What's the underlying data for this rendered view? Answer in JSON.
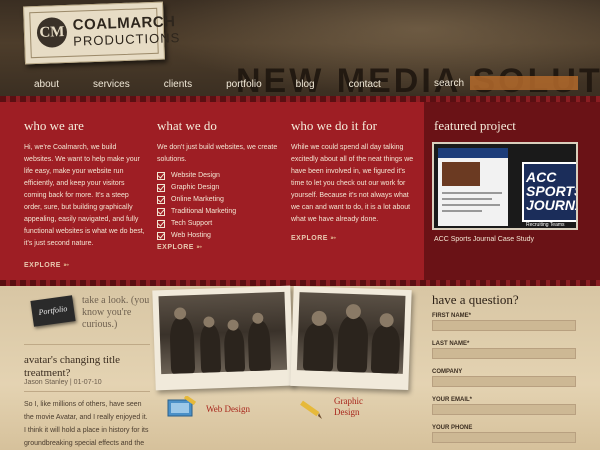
{
  "brand": {
    "logo_mark": "CM",
    "name": "COALMARCH",
    "sub": "PRODUCTIONS"
  },
  "hero": {
    "headline": "NEW MEDIA SOLUTIONS"
  },
  "nav": [
    "about",
    "services",
    "clients",
    "portfolio",
    "blog",
    "contact"
  ],
  "search": {
    "label": "search",
    "value": ""
  },
  "who_we_are": {
    "title": "who we are",
    "body": "Hi, we're Coalmarch, we build websites. We want to help make your life easy, make your website run efficiently, and keep your visitors coming back for more. It's a steep order, sure, but building graphically appealing, easily navigated, and fully functional websites is what we do best, it's just second nature.",
    "explore": "EXPLORE"
  },
  "what_we_do": {
    "title": "what we do",
    "intro": "We don't just build websites, we create solutions.",
    "services": [
      "Website Design",
      "Graphic Design",
      "Online Marketing",
      "Traditional Marketing",
      "Tech Support",
      "Web Hosting"
    ],
    "explore": "EXPLORE"
  },
  "why": {
    "title": "who we do it for",
    "body": "While we could spend all day talking excitedly about all of the neat things we have been involved in, we figured it's time to let you check out our work for yourself. Because it's not always what we can and want to do, it is a lot about what we have already done.",
    "explore": "EXPLORE"
  },
  "featured": {
    "title": "featured project",
    "magazine_title": "ACC SPORTS JOURNAL",
    "magazine_tabs": "Recruiting   Teams",
    "caption": "ACC Sports Journal Case Study"
  },
  "portfolio_tag": "Portfolio",
  "take_look": "take a look. (you know you're curious.)",
  "blog": {
    "title": "avatar's changing title treatment?",
    "meta": "Jason Stanley | 01-07-10",
    "excerpt": "So I, like millions of others, have seen the movie Avatar, and I really enjoyed it. I think it will hold a place in history for its groundbreaking special effects and the story was better than I had anticipated."
  },
  "service_cards": [
    {
      "label": "Web Design",
      "icon": "monitor-pencil-icon"
    },
    {
      "label": "Graphic Design",
      "icon": "pencil-icon"
    }
  ],
  "contact_form": {
    "title": "have a question?",
    "fields": [
      {
        "label": "FIRST NAME*",
        "value": ""
      },
      {
        "label": "LAST NAME*",
        "value": ""
      },
      {
        "label": "COMPANY",
        "value": ""
      },
      {
        "label": "YOUR EMAIL*",
        "value": ""
      },
      {
        "label": "YOUR PHONE",
        "value": ""
      }
    ]
  },
  "colors": {
    "red": "#9e1e24",
    "dark_red": "#6a1216",
    "paper": "#e4d3b2",
    "accent": "#a8261c"
  }
}
